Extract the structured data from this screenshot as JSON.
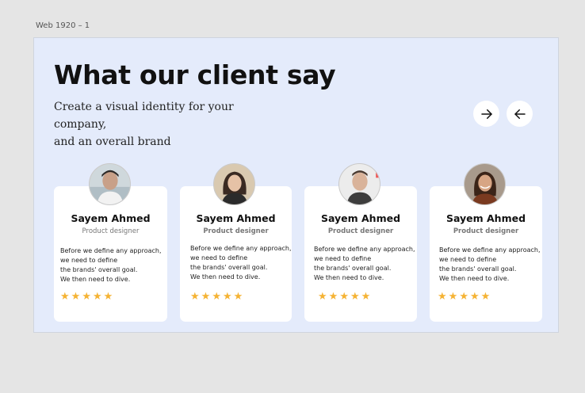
{
  "frame_label": "Web 1920 – 1",
  "heading": "What our client say",
  "subtitle_line1": "Create a visual identity for your company,",
  "subtitle_line2": "and an overall brand",
  "nav": {
    "next_icon": "arrow-right-icon",
    "prev_icon": "arrow-left-icon"
  },
  "colors": {
    "background": "#e4ebfb",
    "star": "#f5b334",
    "card": "#ffffff"
  },
  "cards": [
    {
      "name": "Sayem Ahmed",
      "role": "Product designer",
      "quote": [
        "Before we define any approach,",
        "we need to define",
        "the brands' overall goal.",
        "We then need to dive."
      ],
      "rating": 5
    },
    {
      "name": "Sayem Ahmed",
      "role": "Product designer",
      "quote": [
        "Before we define any approach,",
        "we need to define",
        "the brands' overall goal.",
        "We then need to dive."
      ],
      "rating": 5
    },
    {
      "name": "Sayem Ahmed",
      "role": "Product designer",
      "quote": [
        "Before we define any approach,",
        "we need to define",
        "the brands' overall goal.",
        "We then need to dive."
      ],
      "rating": 5
    },
    {
      "name": "Sayem Ahmed",
      "role": "Product designer",
      "quote": [
        "Before we define any approach,",
        "we need to define",
        "the brands' overall goal.",
        "We then need to dive."
      ],
      "rating": 5
    }
  ]
}
